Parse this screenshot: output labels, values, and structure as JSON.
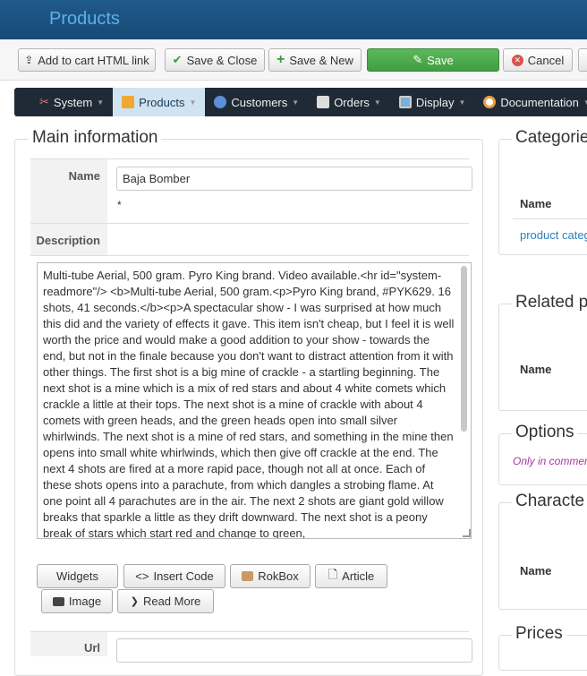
{
  "header": {
    "title": "Products"
  },
  "toolbar": {
    "add_cart_label": "Add to cart HTML link",
    "save_close_label": "Save & Close",
    "save_new_label": "Save & New",
    "save_label": "Save",
    "cancel_label": "Cancel"
  },
  "nav": {
    "items": [
      {
        "label": "System"
      },
      {
        "label": "Products"
      },
      {
        "label": "Customers"
      },
      {
        "label": "Orders"
      },
      {
        "label": "Display"
      },
      {
        "label": "Documentation"
      }
    ]
  },
  "main": {
    "legend": "Main information",
    "name_label": "Name",
    "name_value": "Baja Bomber",
    "required_mark": "*",
    "description_label": "Description",
    "description_text": "Multi-tube Aerial, 500 gram. Pyro King brand. Video available.<hr id=\"system-readmore\"/> <b>Multi-tube Aerial, 500 gram.<p>Pyro King brand, #PYK629. 16 shots, 41 seconds.</b><p>A spectacular show - I was surprised at how much this did and the variety of effects it gave. This item isn't cheap, but I feel it is well worth the price and would make a good addition to your show - towards the end, but not in the finale because you don't want to distract attention from it with other things. The first shot is a big mine of crackle - a startling beginning. The next shot is a mine which is a mix of red stars and about 4 white comets which crackle a little at their tops. The next shot is a mine of crackle with about 4 comets with green heads, and the green heads open into small silver whirlwinds. The next shot is a mine of red stars, and something in the mine then opens into small white whirlwinds, which then give off crackle at the end. The next 4 shots are fired at a more rapid pace, though not all at once. Each of these shots opens into a parachute, from which dangles a strobing flame. At one point all 4 parachutes are in the air. The next 2 shots are giant gold willow breaks that sparkle a little as they drift downward. The next shot is a peony break of stars which start red and change to green,",
    "editor_buttons": {
      "widgets": "Widgets",
      "insert_code": "Insert Code",
      "rokbox": "RokBox",
      "article": "Article",
      "image": "Image",
      "read_more": "Read More"
    },
    "url_label": "Url"
  },
  "sidebar": {
    "categories": {
      "legend": "Categorie",
      "name_header": "Name",
      "link": "product categ"
    },
    "related": {
      "legend": "Related p",
      "name_header": "Name"
    },
    "options": {
      "legend": "Options",
      "note": "Only in commer"
    },
    "characteristics": {
      "legend": "Characte",
      "name_header": "Name"
    },
    "prices": {
      "legend": "Prices"
    }
  }
}
